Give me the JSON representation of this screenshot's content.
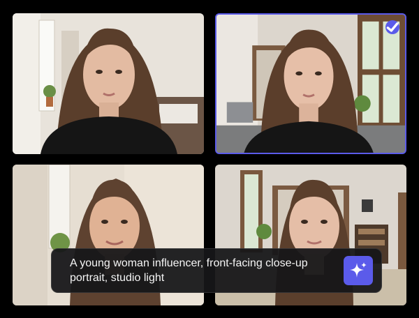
{
  "tiles": [
    {
      "id": "tile-1",
      "selected": false
    },
    {
      "id": "tile-2",
      "selected": true
    },
    {
      "id": "tile-3",
      "selected": false
    },
    {
      "id": "tile-4",
      "selected": false
    }
  ],
  "prompt": {
    "text": "A young woman influencer, front-facing close-up portrait, studio light"
  },
  "icons": {
    "selected": "checkmark-icon",
    "generate": "sparkle-icon"
  },
  "colors": {
    "accent": "#5b5bea",
    "background": "#000000",
    "prompt_bg": "#161618",
    "prompt_text": "#f5f5f5"
  }
}
